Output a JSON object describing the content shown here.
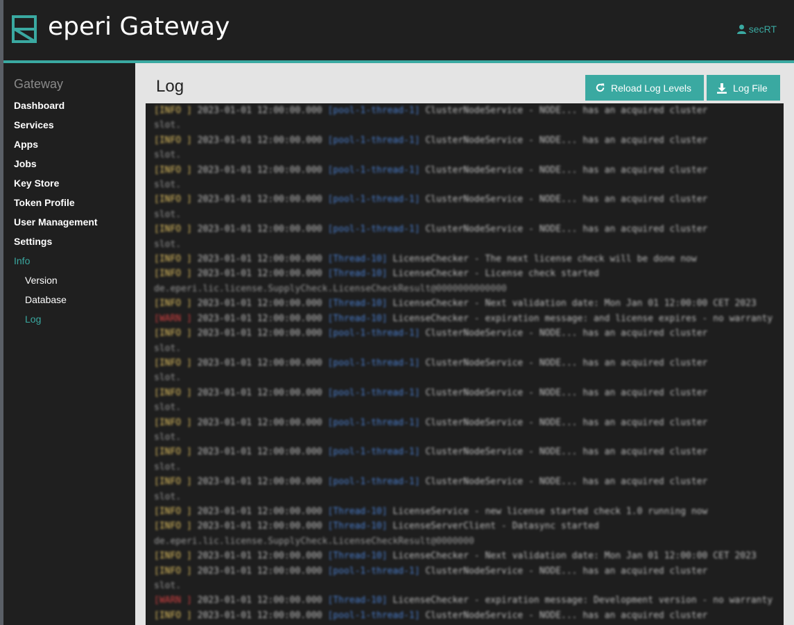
{
  "header": {
    "app_title": "eperi Gateway",
    "user_name": "secRT",
    "accent_color": "#3aa9a1"
  },
  "sidebar": {
    "heading": "Gateway",
    "items": [
      {
        "label": "Dashboard"
      },
      {
        "label": "Services"
      },
      {
        "label": "Apps"
      },
      {
        "label": "Jobs"
      },
      {
        "label": "Key Store"
      },
      {
        "label": "Token Profile"
      },
      {
        "label": "User Management"
      },
      {
        "label": "Settings"
      },
      {
        "label": "Info",
        "active": true
      },
      {
        "label": "Version",
        "sub": true
      },
      {
        "label": "Database",
        "sub": true
      },
      {
        "label": "Log",
        "sub": true,
        "active": true
      }
    ]
  },
  "main": {
    "title": "Log",
    "buttons": {
      "reload": "Reload Log Levels",
      "log_file": "Log File"
    }
  },
  "log": {
    "blurred": true,
    "lines": [
      [
        "[INFO ]",
        " 2023-01-01 12:00:00.000 ",
        "[pool-1-thread-1]",
        " ClusterNodeService - NODE... has an acquired cluster"
      ],
      [
        "",
        "",
        "",
        "slot."
      ],
      [
        "[INFO ]",
        " 2023-01-01 12:00:00.000 ",
        "[pool-1-thread-1]",
        " ClusterNodeService - NODE... has an acquired cluster"
      ],
      [
        "",
        "",
        "",
        "slot."
      ],
      [
        "[INFO ]",
        " 2023-01-01 12:00:00.000 ",
        "[pool-1-thread-1]",
        " ClusterNodeService - NODE... has an acquired cluster"
      ],
      [
        "",
        "",
        "",
        "slot."
      ],
      [
        "[INFO ]",
        " 2023-01-01 12:00:00.000 ",
        "[pool-1-thread-1]",
        " ClusterNodeService - NODE... has an acquired cluster"
      ],
      [
        "",
        "",
        "",
        "slot."
      ],
      [
        "[INFO ]",
        " 2023-01-01 12:00:00.000 ",
        "[pool-1-thread-1]",
        " ClusterNodeService - NODE... has an acquired cluster"
      ],
      [
        "",
        "",
        "",
        "slot."
      ],
      [
        "[INFO ]",
        " 2023-01-01 12:00:00.000 ",
        "[Thread-10]",
        " LicenseChecker - The next license check will be done now"
      ],
      [
        "[INFO ]",
        " 2023-01-01 12:00:00.000 ",
        "[Thread-10]",
        " LicenseChecker - License check started"
      ],
      [
        "",
        "",
        "",
        "de.eperi.lic.license.SupplyCheck.LicenseCheckResult@0000000000000"
      ],
      [
        "[INFO ]",
        " 2023-01-01 12:00:00.000 ",
        "[Thread-10]",
        " LicenseChecker - Next validation date: Mon Jan 01 12:00:00 CET 2023"
      ],
      [
        "[WARN ]",
        " 2023-01-01 12:00:00.000 ",
        "[Thread-10]",
        " LicenseChecker - expiration message: and license expires - no warranty"
      ],
      [
        "[INFO ]",
        " 2023-01-01 12:00:00.000 ",
        "[pool-1-thread-1]",
        " ClusterNodeService - NODE... has an acquired cluster"
      ],
      [
        "",
        "",
        "",
        "slot."
      ],
      [
        "[INFO ]",
        " 2023-01-01 12:00:00.000 ",
        "[pool-1-thread-1]",
        " ClusterNodeService - NODE... has an acquired cluster"
      ],
      [
        "",
        "",
        "",
        "slot."
      ],
      [
        "[INFO ]",
        " 2023-01-01 12:00:00.000 ",
        "[pool-1-thread-1]",
        " ClusterNodeService - NODE... has an acquired cluster"
      ],
      [
        "",
        "",
        "",
        "slot."
      ],
      [
        "[INFO ]",
        " 2023-01-01 12:00:00.000 ",
        "[pool-1-thread-1]",
        " ClusterNodeService - NODE... has an acquired cluster"
      ],
      [
        "",
        "",
        "",
        "slot."
      ],
      [
        "[INFO ]",
        " 2023-01-01 12:00:00.000 ",
        "[pool-1-thread-1]",
        " ClusterNodeService - NODE... has an acquired cluster"
      ],
      [
        "",
        "",
        "",
        "slot."
      ],
      [
        "[INFO ]",
        " 2023-01-01 12:00:00.000 ",
        "[pool-1-thread-1]",
        " ClusterNodeService - NODE... has an acquired cluster"
      ],
      [
        "",
        "",
        "",
        "slot."
      ],
      [
        "[INFO ]",
        " 2023-01-01 12:00:00.000 ",
        "[Thread-10]",
        " LicenseService - new license started check 1.0 running now"
      ],
      [
        "[INFO ]",
        " 2023-01-01 12:00:00.000 ",
        "[Thread-10]",
        " LicenseServerClient - Datasync started"
      ],
      [
        "",
        "",
        "",
        "de.eperi.lic.license.SupplyCheck.LicenseCheckResult@0000000"
      ],
      [
        "[INFO ]",
        " 2023-01-01 12:00:00.000 ",
        "[Thread-10]",
        " LicenseChecker - Next validation date: Mon Jan 01 12:00:00 CET 2023"
      ],
      [
        "[INFO ]",
        " 2023-01-01 12:00:00.000 ",
        "[pool-1-thread-1]",
        " ClusterNodeService - NODE... has an acquired cluster"
      ],
      [
        "",
        "",
        "",
        "slot."
      ],
      [
        "[WARN ]",
        " 2023-01-01 12:00:00.000 ",
        "[Thread-10]",
        " LicenseChecker - expiration message: Development version - no warranty"
      ],
      [
        "[INFO ]",
        " 2023-01-01 12:00:00.000 ",
        "[pool-1-thread-1]",
        " ClusterNodeService - NODE... has an acquired cluster"
      ]
    ]
  }
}
